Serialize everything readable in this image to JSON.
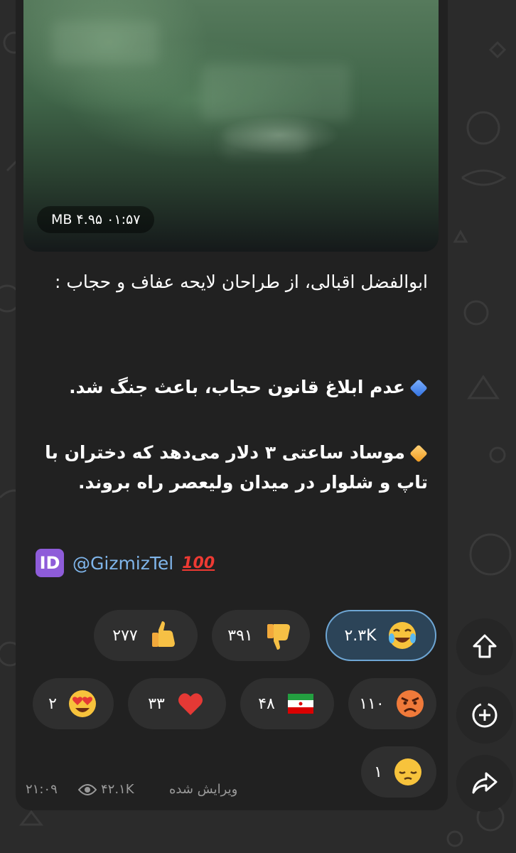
{
  "video": {
    "size": "MB ۴.۹۵",
    "duration": "۰۱:۵۷"
  },
  "message": {
    "intro": "ابوالفضل اقبالی، از طراحان لایحه عفاف و حجاب :",
    "point1": "عدم ابلاغ قانون حجاب، باعث جنگ شد.",
    "point2": "موساد ساعتی ۳ دلار می‌دهد که دختران با تاپ و شلوار در میدان ولیعصر راه بروند.",
    "signature": "@GizmizTel",
    "id_badge": "ID",
    "hundred": "100"
  },
  "reactions": [
    {
      "emoji": "joy-tears",
      "count": "۲.۳K",
      "active": true
    },
    {
      "emoji": "thumbs-down",
      "count": "۳۹۱",
      "active": false
    },
    {
      "emoji": "thumbs-up",
      "count": "۲۷۷",
      "active": false
    },
    {
      "emoji": "angry-face",
      "count": "۱۱۰",
      "active": false
    },
    {
      "emoji": "iran-flag",
      "count": "۴۸",
      "active": false
    },
    {
      "emoji": "red-heart",
      "count": "۳۳",
      "active": false
    },
    {
      "emoji": "heart-eyes",
      "count": "۲",
      "active": false
    },
    {
      "emoji": "pensive-face",
      "count": "۱",
      "active": false
    }
  ],
  "footer": {
    "edited": "ویرایش شده",
    "views": "۴۲.۱K",
    "time": "۲۱:۰۹"
  },
  "colors": {
    "accent": "#6ea6d4",
    "link": "#7fb5ea",
    "bubble": "#212121",
    "background": "#2b2b2b"
  },
  "side_buttons": [
    "scroll-up-icon",
    "add-reaction-icon",
    "share-icon"
  ]
}
